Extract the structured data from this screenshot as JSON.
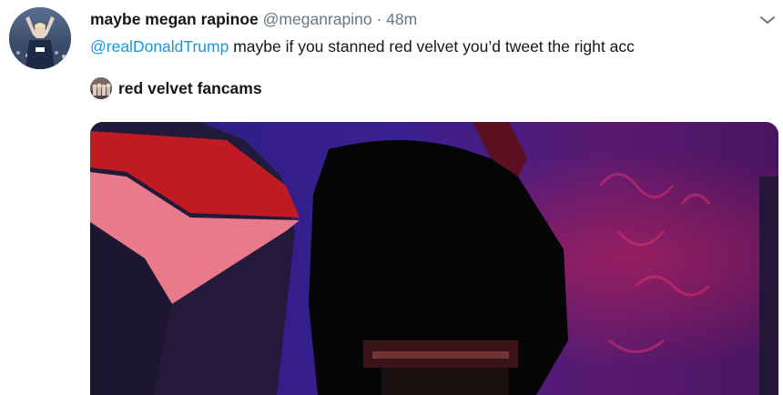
{
  "tweet": {
    "display_name": "maybe megan rapinoe",
    "handle": "@meganrapino",
    "separator": "·",
    "time": "48m",
    "mention": "@realDonaldTrump",
    "text": " maybe if you stanned red velvet you’d tweet the right acc"
  },
  "quote": {
    "display_name": "red velvet fancams"
  },
  "icons": {
    "menu": "chevron-down-icon"
  },
  "colors": {
    "link": "#1b95e0",
    "secondary_text": "#657786",
    "primary_text": "#14171a"
  }
}
